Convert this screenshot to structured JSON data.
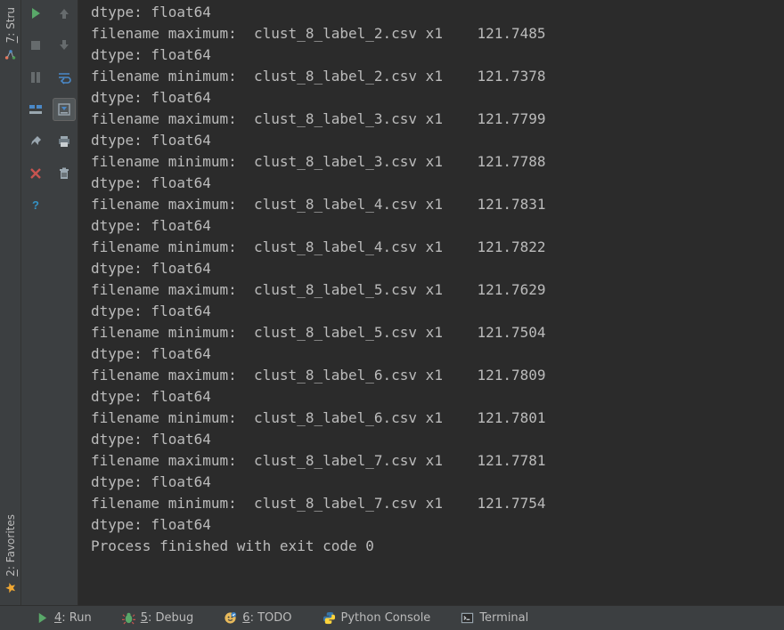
{
  "side_tabs": {
    "structure_prefix": "7",
    "structure_label": ": Stru",
    "favorites_prefix": "2",
    "favorites_label": ": Favorites"
  },
  "run_toolbar": {
    "run": "Run",
    "stop": "Stop",
    "pause": "Pause",
    "dump": "Dump",
    "pin": "Pin",
    "close": "Close",
    "help": "Help"
  },
  "output_toolbar": {
    "up": "Up",
    "down": "Down",
    "soft_wrap": "Soft-Wrap",
    "scroll_end": "Scroll to End",
    "print": "Print",
    "clear": "Clear All"
  },
  "bottom": {
    "run_prefix": "4",
    "run_label": ": Run",
    "debug_prefix": "5",
    "debug_label": ": Debug",
    "todo_prefix": "6",
    "todo_label": ": TODO",
    "python_console": "Python Console",
    "terminal": "Terminal"
  },
  "console": {
    "dtype_line": "dtype: float64",
    "filename_max": "filename maximum:",
    "filename_min": "filename minimum:",
    "x1": "x1",
    "rows": [
      {
        "kind": "max",
        "file": "clust_8_label_2.csv",
        "value": "121.7485"
      },
      {
        "kind": "min",
        "file": "clust_8_label_2.csv",
        "value": "121.7378"
      },
      {
        "kind": "max",
        "file": "clust_8_label_3.csv",
        "value": "121.7799"
      },
      {
        "kind": "min",
        "file": "clust_8_label_3.csv",
        "value": "121.7788"
      },
      {
        "kind": "max",
        "file": "clust_8_label_4.csv",
        "value": "121.7831"
      },
      {
        "kind": "min",
        "file": "clust_8_label_4.csv",
        "value": "121.7822"
      },
      {
        "kind": "max",
        "file": "clust_8_label_5.csv",
        "value": "121.7629"
      },
      {
        "kind": "min",
        "file": "clust_8_label_5.csv",
        "value": "121.7504"
      },
      {
        "kind": "max",
        "file": "clust_8_label_6.csv",
        "value": "121.7809"
      },
      {
        "kind": "min",
        "file": "clust_8_label_6.csv",
        "value": "121.7801"
      },
      {
        "kind": "max",
        "file": "clust_8_label_7.csv",
        "value": "121.7781"
      },
      {
        "kind": "min",
        "file": "clust_8_label_7.csv",
        "value": "121.7754"
      }
    ],
    "finish": "Process finished with exit code 0"
  }
}
